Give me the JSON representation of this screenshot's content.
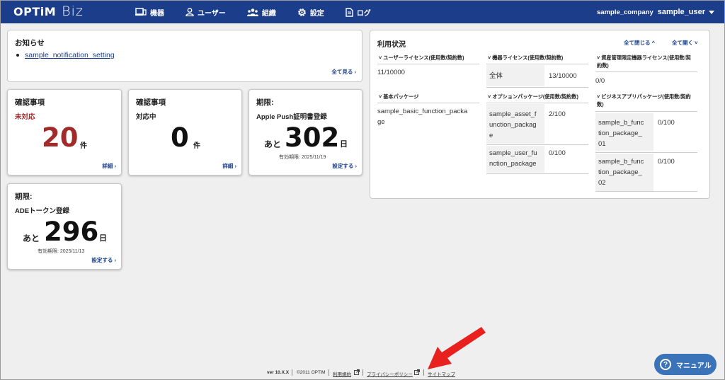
{
  "header": {
    "logo": "OPTiM",
    "product": "Biz",
    "nav": [
      {
        "label": "機器",
        "icon": "device-icon"
      },
      {
        "label": "ユーザー",
        "icon": "user-icon"
      },
      {
        "label": "組織",
        "icon": "organization-icon"
      },
      {
        "label": "設定",
        "icon": "gear-icon"
      },
      {
        "label": "ログ",
        "icon": "log-document-icon"
      }
    ],
    "company": "sample_company",
    "user": "sample_user"
  },
  "notice": {
    "title": "お知らせ",
    "items": [
      "sample_notification_setting"
    ],
    "see_all": "全て見る ›"
  },
  "cards": {
    "unhandled": {
      "title": "確認事項",
      "status": "未対応",
      "count": "20",
      "unit": "件",
      "detail": "詳細 ›"
    },
    "in_progress": {
      "title": "確認事項",
      "status": "対応中",
      "count": "0",
      "unit": "件",
      "detail": "詳細 ›"
    },
    "apple_push": {
      "title": "期限:",
      "subtitle": "Apple Push証明書登録",
      "prefix": "あと",
      "days": "302",
      "unit": "日",
      "expire": "有効期限: 2025/11/19",
      "action": "設定する ›"
    },
    "ade_token": {
      "title": "期限:",
      "subtitle": "ADEトークン登録",
      "prefix": "あと",
      "days": "296",
      "unit": "日",
      "expire": "有効期限: 2025/11/13",
      "action": "設定する ›"
    }
  },
  "usage": {
    "title": "利用状況",
    "collapse_all": "全て閉じる ^",
    "expand_all": "全て開く ˅",
    "user_license": {
      "label": "ユーザーライセンス(使用数/契約数)",
      "value": "11/10000"
    },
    "device_license": {
      "label": "機器ライセンス(使用数/契約数)",
      "row_label": "全体",
      "value": "13/10000"
    },
    "asset_license": {
      "label_1": "資産管理限定機器ライセンス(使用数/契",
      "label_2": "約数)",
      "value": "0/0"
    },
    "basic_package": {
      "label": "基本パッケージ",
      "value_1": "sample_basic_function_packa",
      "value_2": "ge"
    },
    "option_package": {
      "label": "オプションパッケージ(使用数/契約数)",
      "rows": [
        {
          "name_1": "sample_asset_f",
          "name_2": "unction_packag",
          "name_3": "e",
          "value": "2/100"
        },
        {
          "name_1": "sample_user_fu",
          "name_2": "nction_package",
          "value": "0/100"
        }
      ]
    },
    "business_package": {
      "label_1": "ビジネスアプリパッケージ(使用数/契約",
      "label_2": "数)",
      "rows": [
        {
          "name_1": "sample_b_func",
          "name_2": "tion_package_",
          "name_3": "01",
          "value": "0/100"
        },
        {
          "name_1": "sample_b_func",
          "name_2": "tion_package_",
          "name_3": "02",
          "value": "0/100"
        }
      ]
    }
  },
  "footer": {
    "version": "ver 10.X.X",
    "copyright": "©2011 OPTiM",
    "terms": "利用規約",
    "privacy": "プライバシーポリシー",
    "sitemap": "サイトマップ"
  },
  "manual_button": {
    "icon": "?",
    "label": "マニュアル"
  },
  "colors": {
    "header": "#1b3d8a",
    "alert_red": "#a12a2a",
    "annotation_arrow": "#e8201e",
    "manual_button": "#3b73b9"
  }
}
